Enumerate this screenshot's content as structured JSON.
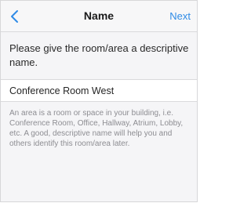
{
  "nav": {
    "back_icon": "chevron-left-icon",
    "title": "Name",
    "next_label": "Next",
    "accent_color": "#2f8be6"
  },
  "prompt_text": "Please give the room/area a descriptive name.",
  "name_field": {
    "value": "Conference Room West",
    "placeholder": ""
  },
  "help_text": "An area is a room or space in your building, i.e. Conference Room, Office, Hallway, Atrium, Lobby, etc. A good, descriptive name will help you and others identify this room/area later."
}
